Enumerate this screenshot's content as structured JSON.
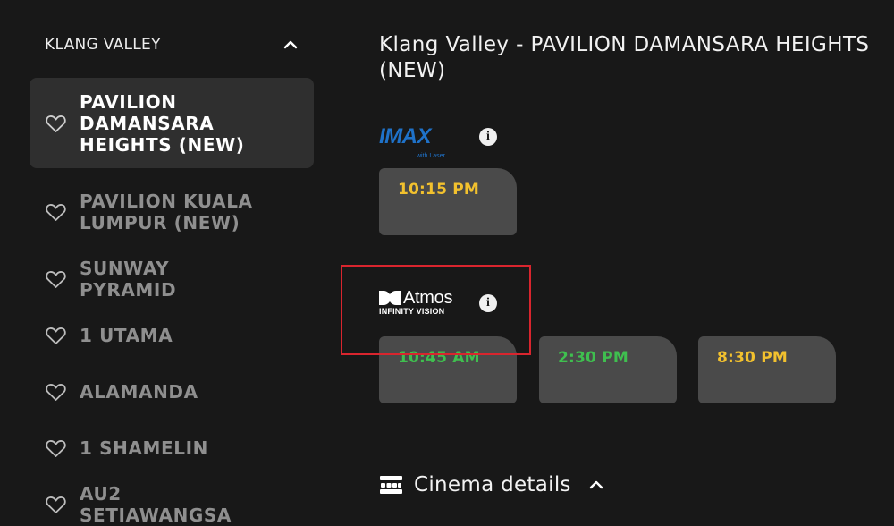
{
  "sidebar": {
    "region_label": "KLANG VALLEY",
    "cinemas": [
      {
        "name": "PAVILION DAMANSARA HEIGHTS (NEW)",
        "selected": true
      },
      {
        "name": "PAVILION KUALA LUMPUR (NEW)",
        "selected": false
      },
      {
        "name": "SUNWAY PYRAMID",
        "selected": false
      },
      {
        "name": "1 UTAMA",
        "selected": false
      },
      {
        "name": "ALAMANDA",
        "selected": false
      },
      {
        "name": "1 SHAMELIN",
        "selected": false
      },
      {
        "name": "AU2 SETIAWANGSA",
        "selected": false
      }
    ]
  },
  "main": {
    "title": "Klang Valley - PAVILION DAMANSARA HEIGHTS (NEW)",
    "formats": [
      {
        "logo_text": "IMAX",
        "logo_sub": "with Laser",
        "logo_color": "#1f72c9",
        "info_icon": "i",
        "showtimes": [
          {
            "time": "10:15 PM",
            "color": "#f2c12e"
          }
        ]
      },
      {
        "logo_text": "Atmos",
        "logo_sub": "INFINITY VISION",
        "logo_color": "#ffffff",
        "info_icon": "i",
        "showtimes": [
          {
            "time": "10:45 AM",
            "color": "#3fbf4f"
          },
          {
            "time": "2:30 PM",
            "color": "#3fbf4f"
          },
          {
            "time": "8:30 PM",
            "color": "#f2c12e"
          }
        ]
      }
    ],
    "details_label": "Cinema details"
  },
  "colors": {
    "background": "#181818",
    "selected_item": "#2f2f2f",
    "showtime_tile": "#4a4a4a",
    "highlight": "#d9252e"
  }
}
